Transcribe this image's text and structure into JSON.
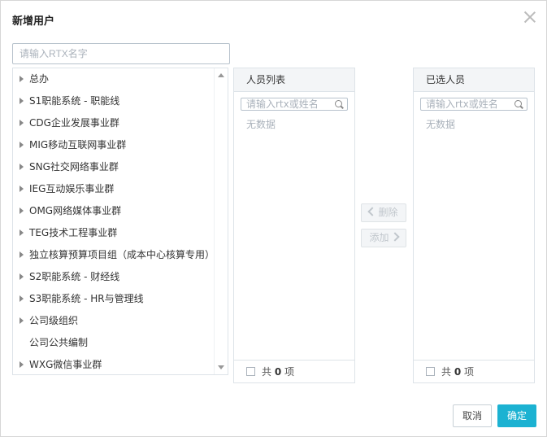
{
  "dialog": {
    "title": "新增用户",
    "search_placeholder": "请输入RTX名字",
    "tree": [
      {
        "label": "总办",
        "expandable": true
      },
      {
        "label": "S1职能系统 - 职能线",
        "expandable": true
      },
      {
        "label": "CDG企业发展事业群",
        "expandable": true
      },
      {
        "label": "MIG移动互联网事业群",
        "expandable": true
      },
      {
        "label": "SNG社交网络事业群",
        "expandable": true
      },
      {
        "label": "IEG互动娱乐事业群",
        "expandable": true
      },
      {
        "label": "OMG网络媒体事业群",
        "expandable": true
      },
      {
        "label": "TEG技术工程事业群",
        "expandable": true
      },
      {
        "label": "独立核算预算项目组（成本中心核算专用）",
        "expandable": true
      },
      {
        "label": "S2职能系统 - 财经线",
        "expandable": true
      },
      {
        "label": "S3职能系统 - HR与管理线",
        "expandable": true
      },
      {
        "label": "公司级组织",
        "expandable": true
      },
      {
        "label": "公司公共编制",
        "expandable": false
      },
      {
        "label": "WXG微信事业群",
        "expandable": true
      }
    ],
    "list_panel": {
      "header": "人员列表",
      "search_placeholder": "请输入rtx或姓名",
      "empty": "无数据",
      "footer_prefix": "共",
      "count": "0",
      "footer_suffix": "项"
    },
    "selected_panel": {
      "header": "已选人员",
      "search_placeholder": "请输入rtx或姓名",
      "empty": "无数据",
      "footer_prefix": "共",
      "count": "0",
      "footer_suffix": "项"
    },
    "delete_label": "删除",
    "add_label": "添加",
    "cancel_label": "取消",
    "ok_label": "确定",
    "colors": {
      "accent": "#1cb2d2",
      "border": "#dde3e8"
    }
  }
}
